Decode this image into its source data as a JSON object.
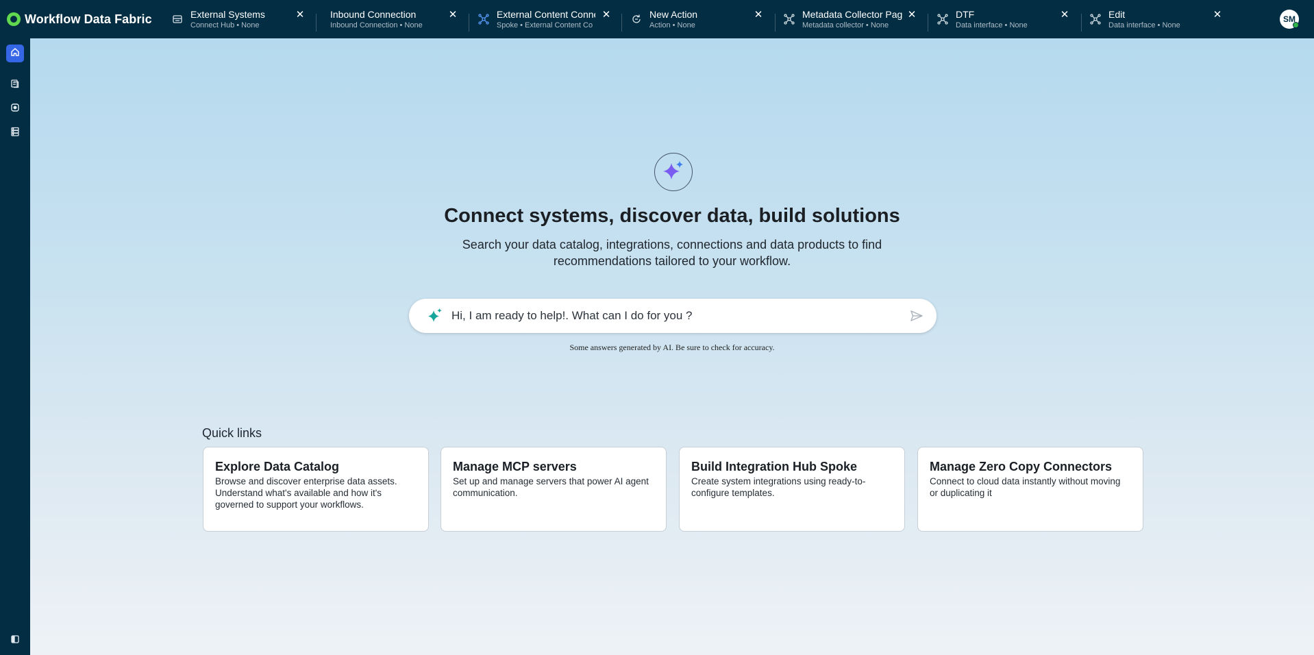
{
  "app": {
    "title": "Workflow Data Fabric"
  },
  "tabs": [
    {
      "title": "External Systems",
      "subtitle": "Connect Hub • None",
      "icon": "database-stack-icon"
    },
    {
      "title": "Inbound Connection",
      "subtitle": "Inbound Connection • None",
      "icon": "none"
    },
    {
      "title": "External Content Conne",
      "subtitle": "Spoke • External Content Co",
      "icon": "network-nodes-icon"
    },
    {
      "title": "New Action",
      "subtitle": "Action • None",
      "icon": "action-refresh-icon"
    },
    {
      "title": "Metadata Collector Page",
      "subtitle": "Metadata collector • None",
      "icon": "network-nodes-icon"
    },
    {
      "title": "DTF",
      "subtitle": "Data interface • None",
      "icon": "network-nodes-icon"
    },
    {
      "title": "Edit",
      "subtitle": "Data interface • None",
      "icon": "network-nodes-icon"
    }
  ],
  "tab_close_glyph": "✕",
  "user": {
    "initials": "SM",
    "status_color": "#2fb34a"
  },
  "sidebar": {
    "items": [
      {
        "icon": "home-icon",
        "active": true
      },
      {
        "icon": "documents-icon",
        "active": false
      },
      {
        "icon": "target-icon",
        "active": false
      },
      {
        "icon": "data-stack-icon",
        "active": false
      }
    ],
    "footer_icon": "collapse-sidebar-icon"
  },
  "hero": {
    "icon": "sparkle-icon",
    "title": "Connect systems, discover data, build solutions",
    "subtitle": "Search your data catalog, integrations, connections and data products to find recommendations tailored to your workflow."
  },
  "search": {
    "placeholder": "Hi, I am ready to help!. What can I do for you ?",
    "disclaimer": "Some answers generated by AI. Be sure to check for accuracy."
  },
  "quick_links": {
    "title": "Quick links",
    "cards": [
      {
        "title": "Explore Data Catalog",
        "description": "Browse and discover enterprise data assets. Understand what's available and how it's governed to support your workflows."
      },
      {
        "title": "Manage MCP servers",
        "description": "Set up and manage servers that power AI agent communication."
      },
      {
        "title": "Build Integration Hub Spoke",
        "description": "Create system integrations using ready-to-configure templates."
      },
      {
        "title": "Manage Zero Copy Connectors",
        "description": "Connect to cloud data instantly without moving or duplicating it"
      }
    ]
  },
  "colors": {
    "topbar": "#032d42",
    "active_nav": "#3566e6",
    "brand_logo": "#62d84e",
    "sparkle_purple": "#7a5cf0",
    "sparkle_teal": "#17a69b"
  }
}
